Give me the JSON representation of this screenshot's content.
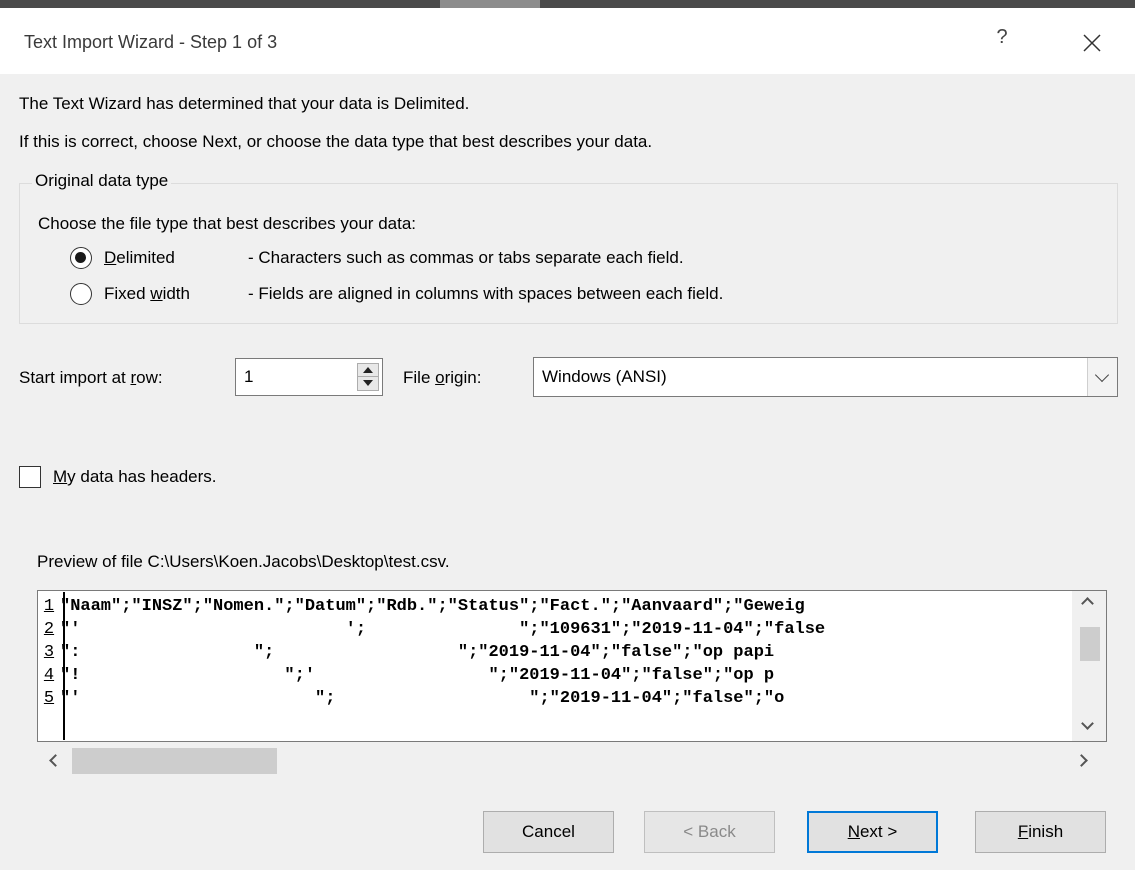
{
  "window": {
    "title": "Text Import Wizard - Step 1 of 3",
    "help_label": "?"
  },
  "intro": {
    "line1": "The Text Wizard has determined that your data is Delimited.",
    "line2": "If this is correct, choose Next, or choose the data type that best describes your data."
  },
  "original_data_type": {
    "legend": "Original data type",
    "prompt": "Choose the file type that best describes your data:",
    "options": [
      {
        "mnemonic": "D",
        "rest": "elimited",
        "description": "- Characters such as commas or tabs separate each field.",
        "selected": true
      },
      {
        "prefix": "Fixed ",
        "mnemonic": "w",
        "rest": "idth",
        "description": "- Fields are aligned in columns with spaces between each field.",
        "selected": false
      }
    ]
  },
  "start_row": {
    "prefix": "Start import at ",
    "mnemonic": "r",
    "suffix": "ow:",
    "value": "1"
  },
  "file_origin": {
    "prefix": "File ",
    "mnemonic": "o",
    "suffix": "rigin:",
    "value": "Windows (ANSI)"
  },
  "headers_checkbox": {
    "mnemonic": "M",
    "rest": "y data has headers.",
    "checked": false
  },
  "preview": {
    "label": "Preview of file C:\\Users\\Koen.Jacobs\\Desktop\\test.csv.",
    "rows": [
      {
        "num": "1",
        "text": "\"Naam\";\"INSZ\";\"Nomen.\";\"Datum\";\"Rdb.\";\"Status\";\"Fact.\";\"Aanvaard\";\"Geweig"
      },
      {
        "num": "2",
        "text": "\"'                          ';               \";\"109631\";\"2019-11-04\";\"false"
      },
      {
        "num": "3",
        "text": "\":                 \";                  \";\"2019-11-04\";\"false\";\"op papi"
      },
      {
        "num": "4",
        "text": "\"!                    \";'                 \";\"2019-11-04\";\"false\";\"op p"
      },
      {
        "num": "5",
        "text": "\"'                       \";                   \";\"2019-11-04\";\"false\";\"o"
      }
    ]
  },
  "buttons": {
    "cancel": "Cancel",
    "back": "< Back",
    "next_mnemonic": "N",
    "next_rest": "ext >",
    "finish_mnemonic": "F",
    "finish_rest": "inish"
  }
}
